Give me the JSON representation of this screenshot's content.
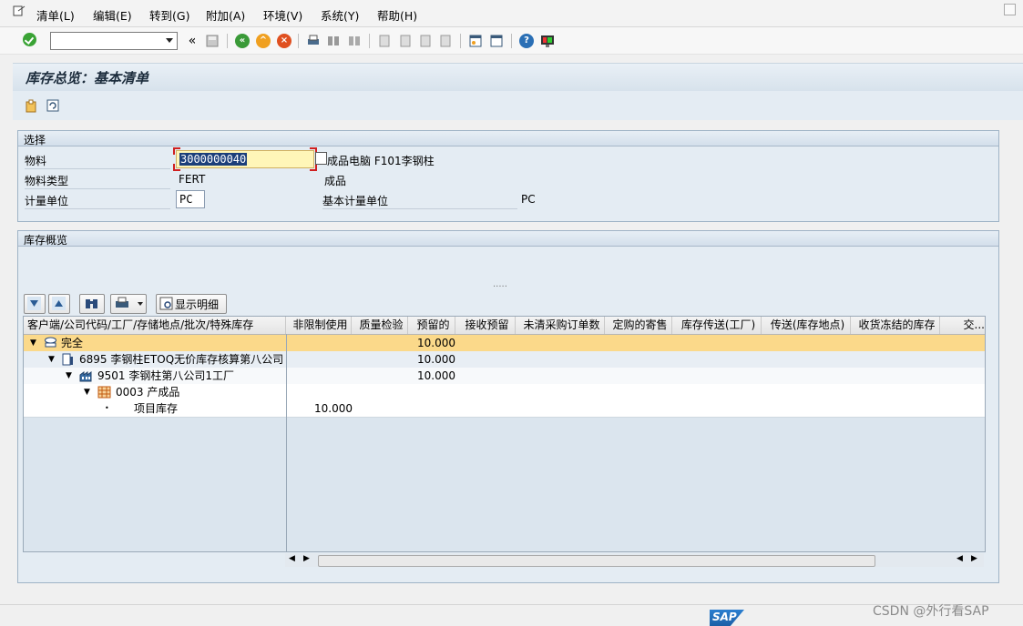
{
  "menu": {
    "items": [
      "清单(L)",
      "编辑(E)",
      "转到(G)",
      "附加(A)",
      "环境(V)",
      "系统(Y)",
      "帮助(H)"
    ]
  },
  "toolbar": {
    "command_value": "",
    "history_back": "«"
  },
  "title": "库存总览：基本清单",
  "selection": {
    "header": "选择",
    "material_label": "物料",
    "material_value": "3000000040",
    "material_desc": "成品电脑 F101李钢柱",
    "type_label": "物料类型",
    "type_value": "FERT",
    "type_desc": "成品",
    "uom_label": "计量单位",
    "uom_value": "PC",
    "base_uom_label": "基本计量单位",
    "base_uom_value": "PC"
  },
  "overview": {
    "header": "库存概览",
    "splitter": "·····",
    "detail_button": "显示明细"
  },
  "grid": {
    "columns": [
      "客户端/公司代码/工厂/存储地点/批次/特殊库存",
      "非限制使用",
      "质量检验",
      "预留的",
      "接收预留",
      "未清采购订单数",
      "定购的寄售",
      "库存传送(工厂)",
      "传送(库存地点)",
      "收货冻结的库存",
      "交..."
    ],
    "rows": [
      {
        "label": "完全",
        "unrestricted": "",
        "quality": "",
        "reserved": "10.000"
      },
      {
        "label": "6895 李钢柱ETOQ无价库存核算第八公司",
        "unrestricted": "",
        "quality": "",
        "reserved": "10.000"
      },
      {
        "label": "9501 李钢柱第八公司1工厂",
        "unrestricted": "",
        "quality": "",
        "reserved": "10.000"
      },
      {
        "label": "0003 产成品",
        "unrestricted": "",
        "quality": "",
        "reserved": ""
      },
      {
        "label": "项目库存",
        "unrestricted": "10.000",
        "quality": "",
        "reserved": ""
      }
    ]
  },
  "footer": {
    "watermark": "CSDN @外行看SAP",
    "logo": "SAP"
  },
  "colors": {
    "selected_row": "#fbd98a",
    "title_text": "#1c2c3c",
    "panel_bg": "#e4ecf3"
  }
}
